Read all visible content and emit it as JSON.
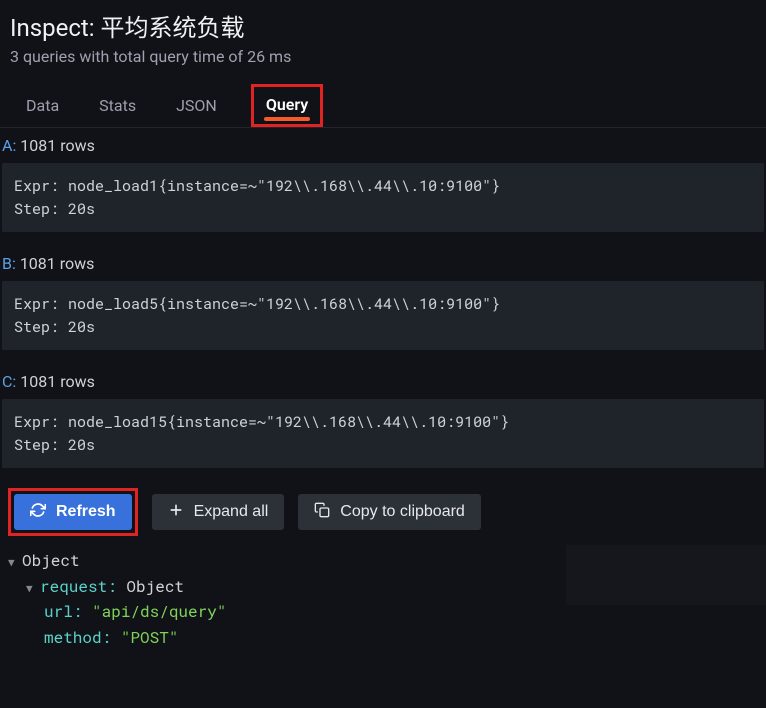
{
  "header": {
    "title": "Inspect: 平均系统负载",
    "subtitle": "3 queries with total query time of 26 ms"
  },
  "tabs": {
    "data": "Data",
    "stats": "Stats",
    "json": "JSON",
    "query": "Query"
  },
  "queries": [
    {
      "letter": "A:",
      "rows": "1081 rows",
      "expr": "Expr: node_load1{instance=~\"192\\\\.168\\\\.44\\\\.10:9100\"}",
      "step": "Step: 20s"
    },
    {
      "letter": "B:",
      "rows": "1081 rows",
      "expr": "Expr: node_load5{instance=~\"192\\\\.168\\\\.44\\\\.10:9100\"}",
      "step": "Step: 20s"
    },
    {
      "letter": "C:",
      "rows": "1081 rows",
      "expr": "Expr: node_load15{instance=~\"192\\\\.168\\\\.44\\\\.10:9100\"}",
      "step": "Step: 20s"
    }
  ],
  "buttons": {
    "refresh": "Refresh",
    "expand": "Expand all",
    "copy": "Copy to clipboard"
  },
  "json_tree": {
    "root": "Object",
    "request_key": "request:",
    "request_val": "Object",
    "url_key": "url:",
    "url_val": "\"api/ds/query\"",
    "method_key": "method:",
    "method_val": "\"POST\""
  }
}
